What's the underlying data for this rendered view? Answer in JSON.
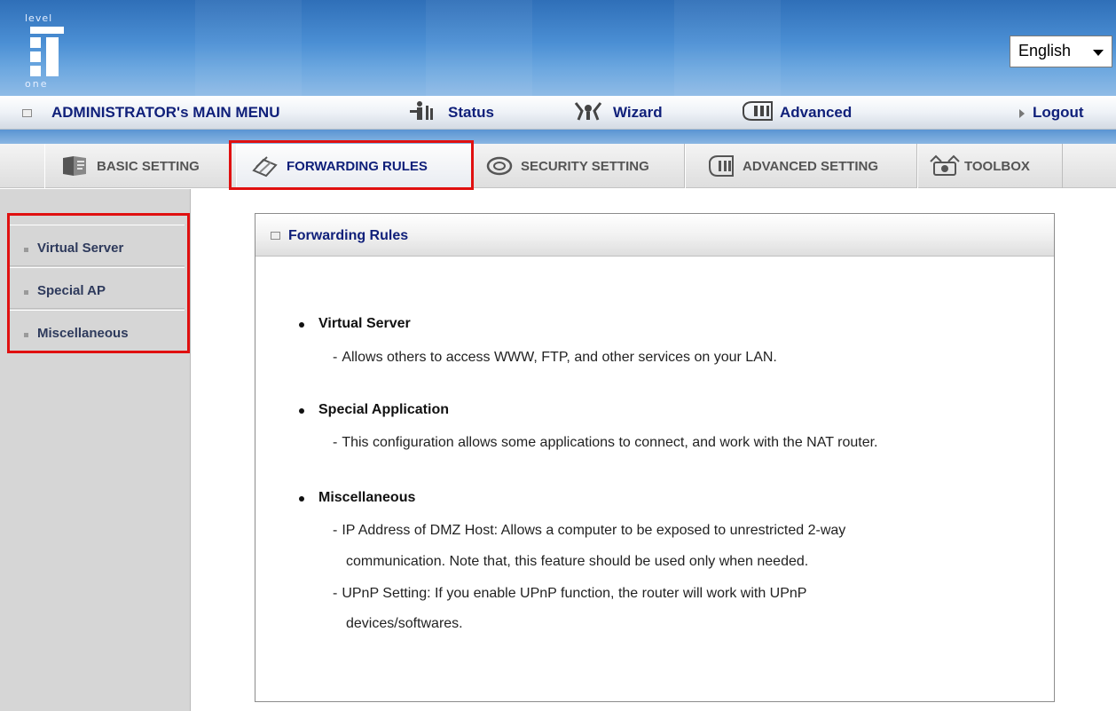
{
  "header": {
    "logo_top": "level",
    "logo_bottom": "one",
    "language": {
      "selected": "English"
    }
  },
  "menubar": {
    "title": "ADMINISTRATOR's MAIN MENU",
    "items": [
      {
        "label": "Status",
        "icon": "status-icon"
      },
      {
        "label": "Wizard",
        "icon": "wizard-icon"
      },
      {
        "label": "Advanced",
        "icon": "advanced-icon"
      }
    ],
    "logout": "Logout"
  },
  "tabs": [
    {
      "label": "BASIC SETTING",
      "icon": "basic-setting-icon",
      "active": false
    },
    {
      "label": "FORWARDING RULES",
      "icon": "forwarding-rules-icon",
      "active": true
    },
    {
      "label": "SECURITY SETTING",
      "icon": "security-setting-icon",
      "active": false
    },
    {
      "label": "ADVANCED SETTING",
      "icon": "advanced-setting-icon",
      "active": false
    },
    {
      "label": "TOOLBOX",
      "icon": "toolbox-icon",
      "active": false
    }
  ],
  "sidebar": {
    "items": [
      {
        "label": "Virtual Server"
      },
      {
        "label": "Special AP"
      },
      {
        "label": "Miscellaneous"
      }
    ]
  },
  "panel": {
    "title": "Forwarding Rules",
    "sections": [
      {
        "title": "Virtual Server",
        "lines": [
          "Allows others to access WWW, FTP, and other services on your LAN."
        ]
      },
      {
        "title": "Special Application",
        "lines": [
          "This configuration allows some applications to connect, and work with the NAT router."
        ]
      },
      {
        "title": "Miscellaneous",
        "lines": [
          "IP Address of DMZ Host: Allows a computer to be exposed to unrestricted 2-way",
          "communication. Note that, this feature should be used only when needed.",
          "UPnP Setting: If you enable UPnP function, the router will work with UPnP",
          "devices/softwares."
        ]
      }
    ]
  },
  "colors": {
    "highlight": "#e01010",
    "menu_text": "#10207a",
    "header_blue": "#4b8fd4"
  }
}
